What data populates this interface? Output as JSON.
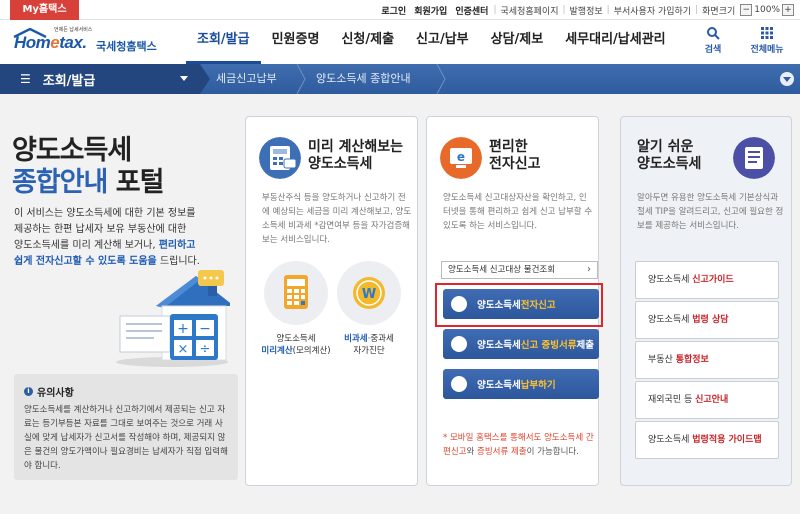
{
  "topbar": {
    "my_tab": "My홈택스",
    "links": [
      "로그인",
      "회원가입",
      "인증센터"
    ],
    "sub_links": [
      "국세청홈페이지",
      "발행정보",
      "부서사용자 가입하기",
      "화면크기"
    ],
    "zoom_minus": "−",
    "zoom_value": "100%",
    "zoom_plus": "+"
  },
  "header": {
    "logo_sub": "언제든 납세서비스",
    "logo_text_a": "Hom",
    "logo_text_b": "e",
    "logo_text_c": "tax.",
    "logo_org": "국세청홈택스",
    "nav": [
      "조회/발급",
      "민원증명",
      "신청/제출",
      "신고/납부",
      "상담/제보",
      "세무대리/납세관리"
    ],
    "search_label": "검색",
    "menu_label": "전체메뉴"
  },
  "breadcrumb": {
    "section": "조회/발급",
    "items": [
      "세금신고납부",
      "양도소득세 종합안내"
    ]
  },
  "intro": {
    "title_line1": "양도소득세",
    "title_line2_blue": "종합안내",
    "title_line2_dark": " 포털",
    "desc_line1": "이 서비스는 양도소득세에 대한 기본 정보를",
    "desc_line2": "제공하는 한편 납세자 보유 부동산에 대한",
    "desc_line3a": "양도소득세를 미리 계산해 보거나, ",
    "desc_line3b": "편리하고",
    "desc_line4a": "쉽게 전자신고할 수 있도록 도움을",
    "desc_line4b": " 드립니다."
  },
  "notice": {
    "title": "유의사항",
    "body": "양도소득세를 계산하거나 신고하기에서 제공되는 신고 자료는 등기부등본 자료를 그대로 보여주는 것으로 거래 사실에 맞게 납세자가 신고서를 작성해야 하며, 제공되지 않은 물건의 양도가액이나 필요경비는 납세자가 직접 입력해야 합니다."
  },
  "card1": {
    "title_line1": "미리 계산해보는",
    "title_line2": "양도소득세",
    "desc": "부동산주식 등을 양도하거나 신고하기 전에 예상되는 세금을 미리 계산해보고, 양도소득세 비과세 *감면여부 등을 자가검증해보는 서비스입니다.",
    "item1_line1": "양도소득세",
    "item1_line2a": "미리계산",
    "item1_line2b": "(모의계산)",
    "item2_line1a": "비과세",
    "item2_line1b": "·중과세",
    "item2_line2": "자가진단"
  },
  "card2": {
    "title_line1": "편리한",
    "title_line2": "전자신고",
    "desc": "양도소득세 신고대상자산을 확인하고, 인터넷을 통해 편리하고 쉽게 신고 납부할 수 있도록 하는 서비스입니다.",
    "select_label": "양도소득세 신고대상 물건조회",
    "btn1_a": "양도소득세 ",
    "btn1_b": "전자신고",
    "btn2_a": "양도소득세 ",
    "btn2_b": "신고 증빙서류",
    "btn2_c": " 제출",
    "btn3_a": "양도소득세 ",
    "btn3_b": "납부하기",
    "note_a": "* 모바일 홈택스를 통해서도 ",
    "note_b": "양도소득세 간편신고",
    "note_c": "와 ",
    "note_d": "증빙서류 제출",
    "note_e": "이 가능합니다."
  },
  "card3": {
    "title_line1": "알기 쉬운",
    "title_line2": "양도소득세",
    "desc": "알아두면 유용한 양도소득세 기본상식과 절세 TIP을 알려드리고, 신고에 필요한 정보를 제공하는 서비스입니다.",
    "btns": [
      {
        "a": "양도소득세 ",
        "b": "신고가이드"
      },
      {
        "a": "양도소득세 ",
        "b": "법령 상담"
      },
      {
        "a": "부동산 ",
        "b": "통합정보"
      },
      {
        "a": "재외국민 등 ",
        "b": "신고안내"
      },
      {
        "a": "양도소득세 ",
        "b": "법령적용 가이드맵"
      }
    ]
  },
  "colors": {
    "brand_blue": "#1a58a8",
    "nav_bar": "#2f5c9e",
    "button_blue": "#2d579c",
    "highlight_red": "#e0262a",
    "accent_yellow": "#ffc22c"
  }
}
